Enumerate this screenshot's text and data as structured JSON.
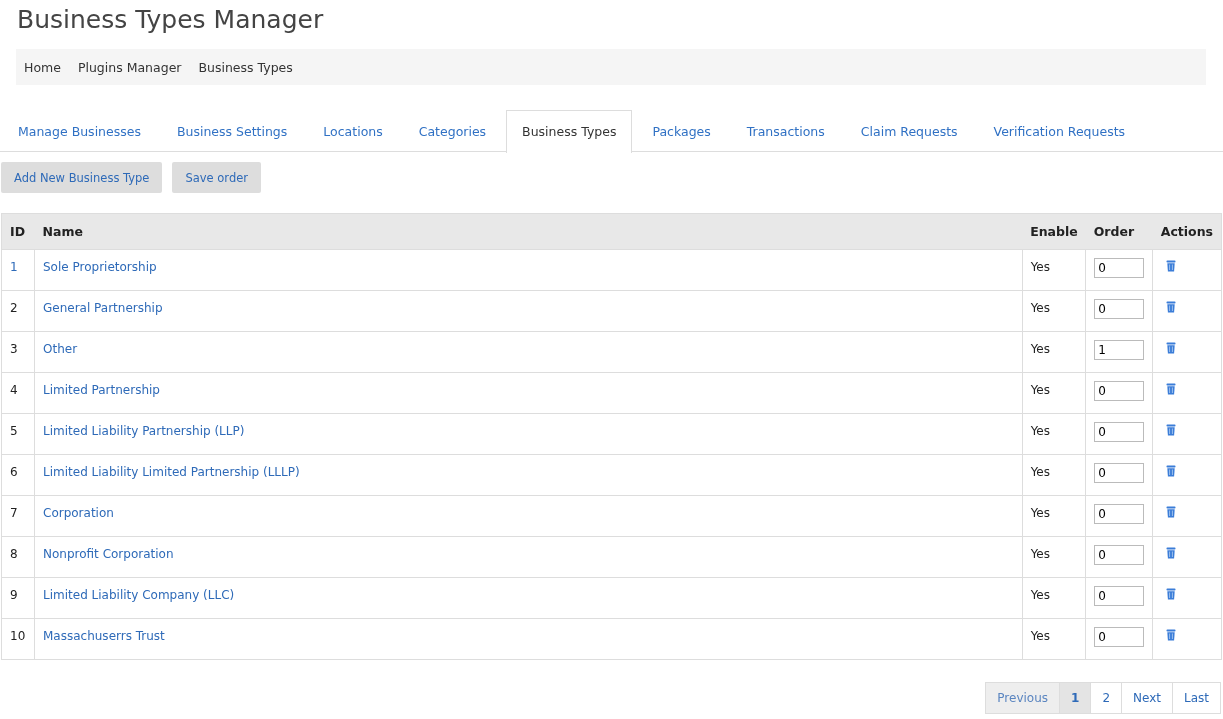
{
  "page_title": "Business Types Manager",
  "breadcrumb": [
    "Home",
    "Plugins Manager",
    "Business Types"
  ],
  "tabs": [
    {
      "label": "Manage Businesses",
      "selected": false
    },
    {
      "label": "Business Settings",
      "selected": false
    },
    {
      "label": "Locations",
      "selected": false
    },
    {
      "label": "Categories",
      "selected": false
    },
    {
      "label": "Business Types",
      "selected": true
    },
    {
      "label": "Packages",
      "selected": false
    },
    {
      "label": "Transactions",
      "selected": false
    },
    {
      "label": "Claim Requests",
      "selected": false
    },
    {
      "label": "Verification Requests",
      "selected": false
    }
  ],
  "buttons": [
    "Add New Business Type",
    "Save order"
  ],
  "table": {
    "columns": [
      "ID",
      "Name",
      "Enable",
      "Order",
      "Actions"
    ],
    "rows": [
      {
        "id": "1",
        "name": "Sole Proprietorship",
        "enable": "Yes",
        "order": "0",
        "selected": true
      },
      {
        "id": "2",
        "name": "General Partnership",
        "enable": "Yes",
        "order": "0",
        "selected": false
      },
      {
        "id": "3",
        "name": "Other",
        "enable": "Yes",
        "order": "1",
        "selected": false
      },
      {
        "id": "4",
        "name": "Limited Partnership",
        "enable": "Yes",
        "order": "0",
        "selected": false
      },
      {
        "id": "5",
        "name": "Limited Liability Partnership (LLP)",
        "enable": "Yes",
        "order": "0",
        "selected": false
      },
      {
        "id": "6",
        "name": "Limited Liability Limited Partnership (LLLP)",
        "enable": "Yes",
        "order": "0",
        "selected": false
      },
      {
        "id": "7",
        "name": "Corporation",
        "enable": "Yes",
        "order": "0",
        "selected": false
      },
      {
        "id": "8",
        "name": "Nonprofit Corporation",
        "enable": "Yes",
        "order": "0",
        "selected": false
      },
      {
        "id": "9",
        "name": "Limited Liability Company (LLC)",
        "enable": "Yes",
        "order": "0",
        "selected": false
      },
      {
        "id": "10",
        "name": "Massachuserrs Trust",
        "enable": "Yes",
        "order": "0",
        "selected": false
      }
    ]
  },
  "pagination": [
    {
      "label": "Previous",
      "selected": false,
      "disabled": true
    },
    {
      "label": "1",
      "selected": true,
      "disabled": false
    },
    {
      "label": "2",
      "selected": false,
      "disabled": false
    },
    {
      "label": "Next",
      "selected": false,
      "disabled": false
    },
    {
      "label": "Last",
      "selected": false,
      "disabled": false
    }
  ]
}
